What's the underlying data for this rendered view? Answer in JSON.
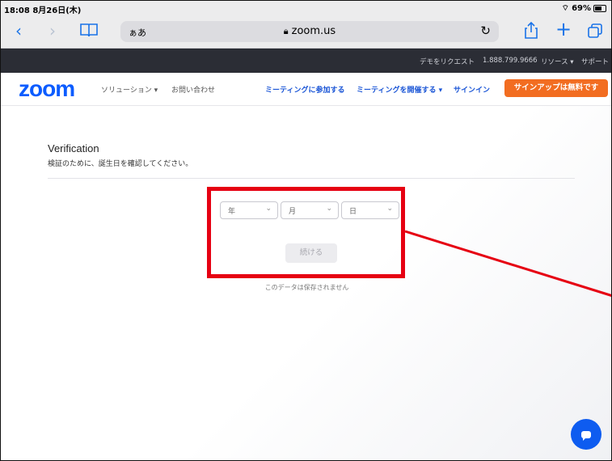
{
  "status": {
    "time": "18:08",
    "date": "8月26日(木)",
    "battery": "69%"
  },
  "browser": {
    "reader_label": "ぁあ",
    "url": "zoom.us",
    "icons": {
      "back": "chevron-left-icon",
      "forward": "chevron-right-icon",
      "bookmarks": "book-icon",
      "reload": "reload-icon",
      "share": "share-icon",
      "new_tab": "plus-icon",
      "tabs": "tabs-icon"
    }
  },
  "topbar": {
    "demo": "デモをリクエスト",
    "phone": "1.888.799.9666",
    "resources": "リソース ▾",
    "support": "サポート"
  },
  "nav": {
    "logo": "zoom",
    "solutions": "ソリューション ▾",
    "contact": "お問い合わせ",
    "join": "ミーティングに参加する",
    "host": "ミーティングを開催する ▾",
    "signin": "サインイン",
    "signup": "サインアップは無料です"
  },
  "verification": {
    "title": "Verification",
    "subtitle": "検証のために、誕生日を確認してください。",
    "year_label": "年",
    "month_label": "月",
    "day_label": "日",
    "continue_label": "続ける",
    "note": "このデータは保存されません"
  },
  "colors": {
    "zoom_blue": "#0b5cff",
    "signup_orange": "#f26d21",
    "highlight_red": "#e60012",
    "chat_blue": "#0e5cf0"
  }
}
